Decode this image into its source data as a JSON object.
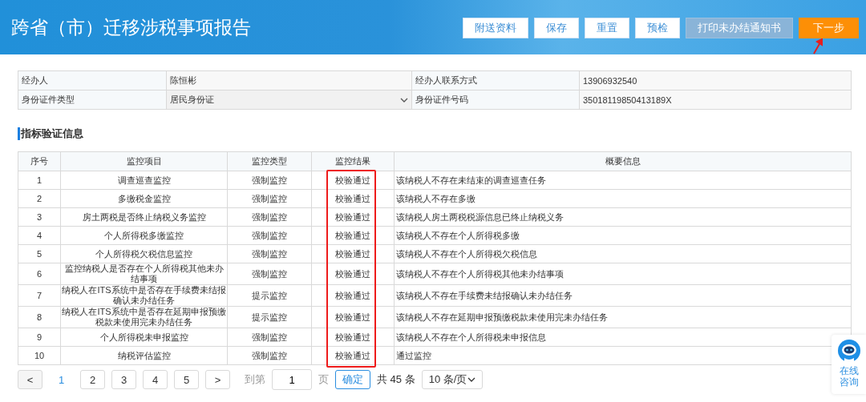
{
  "header": {
    "title": "跨省（市）迁移涉税事项报告",
    "buttons": [
      {
        "label": "附送资料",
        "kind": "plain",
        "disabled": false
      },
      {
        "label": "保存",
        "kind": "plain",
        "disabled": false
      },
      {
        "label": "重置",
        "kind": "plain",
        "disabled": false
      },
      {
        "label": "预检",
        "kind": "plain",
        "disabled": false
      },
      {
        "label": "打印未办结通知书",
        "kind": "plain",
        "disabled": true
      },
      {
        "label": "下一步",
        "kind": "primary",
        "disabled": false
      }
    ]
  },
  "agent_info": {
    "rows": [
      {
        "label": "经办人",
        "value": "陈恒彬",
        "kind": "text",
        "label2": "经办人联系方式",
        "value2": "13906932540"
      },
      {
        "label": "身份证件类型",
        "value": "居民身份证",
        "kind": "select",
        "label2": "身份证件号码",
        "value2": "35018119850413189X"
      }
    ]
  },
  "verification": {
    "title": "指标验证信息",
    "columns": [
      "序号",
      "监控项目",
      "监控类型",
      "监控结果",
      "概要信息"
    ],
    "rows": [
      {
        "no": "1",
        "item": "调查巡查监控",
        "type": "强制监控",
        "result": "校验通过",
        "summary": "该纳税人不存在未结束的调查巡查任务"
      },
      {
        "no": "2",
        "item": "多缴税金监控",
        "type": "强制监控",
        "result": "校验通过",
        "summary": "该纳税人不存在多缴"
      },
      {
        "no": "3",
        "item": "房土两税是否终止纳税义务监控",
        "type": "强制监控",
        "result": "校验通过",
        "summary": "该纳税人房土两税税源信息已终止纳税义务"
      },
      {
        "no": "4",
        "item": "个人所得税多缴监控",
        "type": "强制监控",
        "result": "校验通过",
        "summary": "该纳税人不存在个人所得税多缴"
      },
      {
        "no": "5",
        "item": "个人所得税欠税信息监控",
        "type": "强制监控",
        "result": "校验通过",
        "summary": "该纳税人不存在个人所得税欠税信息"
      },
      {
        "no": "6",
        "item": "监控纳税人是否存在个人所得税其他未办结事项",
        "type": "强制监控",
        "result": "校验通过",
        "summary": "该纳税人不存在个人所得税其他未办结事项"
      },
      {
        "no": "7",
        "item": "纳税人在ITS系统中是否存在手续费未结报确认未办结任务",
        "type": "提示监控",
        "result": "校验通过",
        "summary": "该纳税人不存在手续费未结报确认未办结任务"
      },
      {
        "no": "8",
        "item": "纳税人在ITS系统中是否存在延期申报预缴税款未使用完未办结任务",
        "type": "提示监控",
        "result": "校验通过",
        "summary": "该纳税人不存在延期申报预缴税款未使用完未办结任务"
      },
      {
        "no": "9",
        "item": "个人所得税未申报监控",
        "type": "强制监控",
        "result": "校验通过",
        "summary": "该纳税人不存在个人所得税未申报信息"
      },
      {
        "no": "10",
        "item": "纳税评估监控",
        "type": "强制监控",
        "result": "校验通过",
        "summary": "通过监控"
      }
    ]
  },
  "pagination": {
    "prev": "<",
    "next": ">",
    "pages": [
      {
        "label": "1",
        "selected": true
      },
      {
        "label": "2",
        "selected": false
      },
      {
        "label": "3",
        "selected": false
      },
      {
        "label": "4",
        "selected": false
      },
      {
        "label": "5",
        "selected": false
      }
    ],
    "goto_label": "到第",
    "goto_value": "1",
    "page_unit": "页",
    "confirm": "确定",
    "total": "共 45 条",
    "page_size": "10 条/页"
  },
  "chat_widget": {
    "label": "在线咨询"
  }
}
